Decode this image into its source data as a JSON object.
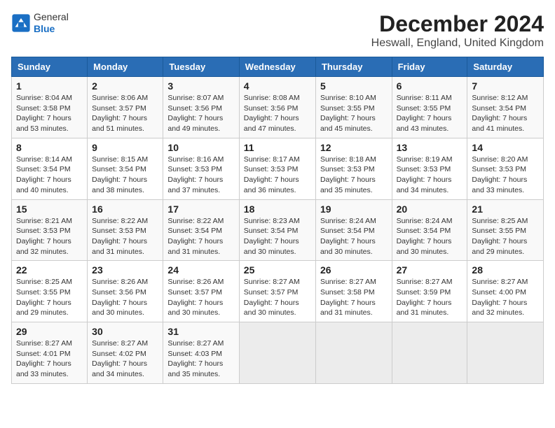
{
  "header": {
    "logo": {
      "general": "General",
      "blue": "Blue"
    },
    "title": "December 2024",
    "subtitle": "Heswall, England, United Kingdom"
  },
  "calendar": {
    "days_of_week": [
      "Sunday",
      "Monday",
      "Tuesday",
      "Wednesday",
      "Thursday",
      "Friday",
      "Saturday"
    ],
    "weeks": [
      [
        {
          "day": "1",
          "sunrise": "Sunrise: 8:04 AM",
          "sunset": "Sunset: 3:58 PM",
          "daylight": "Daylight: 7 hours and 53 minutes."
        },
        {
          "day": "2",
          "sunrise": "Sunrise: 8:06 AM",
          "sunset": "Sunset: 3:57 PM",
          "daylight": "Daylight: 7 hours and 51 minutes."
        },
        {
          "day": "3",
          "sunrise": "Sunrise: 8:07 AM",
          "sunset": "Sunset: 3:56 PM",
          "daylight": "Daylight: 7 hours and 49 minutes."
        },
        {
          "day": "4",
          "sunrise": "Sunrise: 8:08 AM",
          "sunset": "Sunset: 3:56 PM",
          "daylight": "Daylight: 7 hours and 47 minutes."
        },
        {
          "day": "5",
          "sunrise": "Sunrise: 8:10 AM",
          "sunset": "Sunset: 3:55 PM",
          "daylight": "Daylight: 7 hours and 45 minutes."
        },
        {
          "day": "6",
          "sunrise": "Sunrise: 8:11 AM",
          "sunset": "Sunset: 3:55 PM",
          "daylight": "Daylight: 7 hours and 43 minutes."
        },
        {
          "day": "7",
          "sunrise": "Sunrise: 8:12 AM",
          "sunset": "Sunset: 3:54 PM",
          "daylight": "Daylight: 7 hours and 41 minutes."
        }
      ],
      [
        {
          "day": "8",
          "sunrise": "Sunrise: 8:14 AM",
          "sunset": "Sunset: 3:54 PM",
          "daylight": "Daylight: 7 hours and 40 minutes."
        },
        {
          "day": "9",
          "sunrise": "Sunrise: 8:15 AM",
          "sunset": "Sunset: 3:54 PM",
          "daylight": "Daylight: 7 hours and 38 minutes."
        },
        {
          "day": "10",
          "sunrise": "Sunrise: 8:16 AM",
          "sunset": "Sunset: 3:53 PM",
          "daylight": "Daylight: 7 hours and 37 minutes."
        },
        {
          "day": "11",
          "sunrise": "Sunrise: 8:17 AM",
          "sunset": "Sunset: 3:53 PM",
          "daylight": "Daylight: 7 hours and 36 minutes."
        },
        {
          "day": "12",
          "sunrise": "Sunrise: 8:18 AM",
          "sunset": "Sunset: 3:53 PM",
          "daylight": "Daylight: 7 hours and 35 minutes."
        },
        {
          "day": "13",
          "sunrise": "Sunrise: 8:19 AM",
          "sunset": "Sunset: 3:53 PM",
          "daylight": "Daylight: 7 hours and 34 minutes."
        },
        {
          "day": "14",
          "sunrise": "Sunrise: 8:20 AM",
          "sunset": "Sunset: 3:53 PM",
          "daylight": "Daylight: 7 hours and 33 minutes."
        }
      ],
      [
        {
          "day": "15",
          "sunrise": "Sunrise: 8:21 AM",
          "sunset": "Sunset: 3:53 PM",
          "daylight": "Daylight: 7 hours and 32 minutes."
        },
        {
          "day": "16",
          "sunrise": "Sunrise: 8:22 AM",
          "sunset": "Sunset: 3:53 PM",
          "daylight": "Daylight: 7 hours and 31 minutes."
        },
        {
          "day": "17",
          "sunrise": "Sunrise: 8:22 AM",
          "sunset": "Sunset: 3:54 PM",
          "daylight": "Daylight: 7 hours and 31 minutes."
        },
        {
          "day": "18",
          "sunrise": "Sunrise: 8:23 AM",
          "sunset": "Sunset: 3:54 PM",
          "daylight": "Daylight: 7 hours and 30 minutes."
        },
        {
          "day": "19",
          "sunrise": "Sunrise: 8:24 AM",
          "sunset": "Sunset: 3:54 PM",
          "daylight": "Daylight: 7 hours and 30 minutes."
        },
        {
          "day": "20",
          "sunrise": "Sunrise: 8:24 AM",
          "sunset": "Sunset: 3:54 PM",
          "daylight": "Daylight: 7 hours and 30 minutes."
        },
        {
          "day": "21",
          "sunrise": "Sunrise: 8:25 AM",
          "sunset": "Sunset: 3:55 PM",
          "daylight": "Daylight: 7 hours and 29 minutes."
        }
      ],
      [
        {
          "day": "22",
          "sunrise": "Sunrise: 8:25 AM",
          "sunset": "Sunset: 3:55 PM",
          "daylight": "Daylight: 7 hours and 29 minutes."
        },
        {
          "day": "23",
          "sunrise": "Sunrise: 8:26 AM",
          "sunset": "Sunset: 3:56 PM",
          "daylight": "Daylight: 7 hours and 30 minutes."
        },
        {
          "day": "24",
          "sunrise": "Sunrise: 8:26 AM",
          "sunset": "Sunset: 3:57 PM",
          "daylight": "Daylight: 7 hours and 30 minutes."
        },
        {
          "day": "25",
          "sunrise": "Sunrise: 8:27 AM",
          "sunset": "Sunset: 3:57 PM",
          "daylight": "Daylight: 7 hours and 30 minutes."
        },
        {
          "day": "26",
          "sunrise": "Sunrise: 8:27 AM",
          "sunset": "Sunset: 3:58 PM",
          "daylight": "Daylight: 7 hours and 31 minutes."
        },
        {
          "day": "27",
          "sunrise": "Sunrise: 8:27 AM",
          "sunset": "Sunset: 3:59 PM",
          "daylight": "Daylight: 7 hours and 31 minutes."
        },
        {
          "day": "28",
          "sunrise": "Sunrise: 8:27 AM",
          "sunset": "Sunset: 4:00 PM",
          "daylight": "Daylight: 7 hours and 32 minutes."
        }
      ],
      [
        {
          "day": "29",
          "sunrise": "Sunrise: 8:27 AM",
          "sunset": "Sunset: 4:01 PM",
          "daylight": "Daylight: 7 hours and 33 minutes."
        },
        {
          "day": "30",
          "sunrise": "Sunrise: 8:27 AM",
          "sunset": "Sunset: 4:02 PM",
          "daylight": "Daylight: 7 hours and 34 minutes."
        },
        {
          "day": "31",
          "sunrise": "Sunrise: 8:27 AM",
          "sunset": "Sunset: 4:03 PM",
          "daylight": "Daylight: 7 hours and 35 minutes."
        },
        null,
        null,
        null,
        null
      ]
    ]
  }
}
